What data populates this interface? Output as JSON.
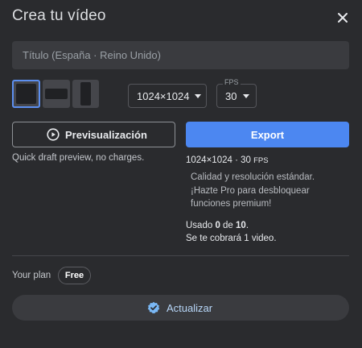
{
  "dialog": {
    "title": "Crea tu vídeo",
    "close_icon": "close-icon"
  },
  "title_field": {
    "placeholder": "Título (España · Reino Unido)",
    "value": ""
  },
  "aspect_ratios": {
    "options": [
      "square",
      "landscape",
      "portrait"
    ],
    "selected": "square"
  },
  "resolution": {
    "value": "1024×1024",
    "icon": "chevron-down-icon"
  },
  "fps": {
    "label": "FPS",
    "value": "30",
    "icon": "chevron-down-icon"
  },
  "actions": {
    "preview_label": "Previsualización",
    "preview_icon": "play-circle-icon",
    "export_label": "Export",
    "export_color": "#4c87f1"
  },
  "preview_hint": "Quick draft preview, no charges.",
  "export_info": {
    "resolution": "1024×1024",
    "separator": " · ",
    "fps_value": "30",
    "fps_unit": "FPS",
    "note": "Calidad y resolución estándar. ¡Hazte Pro para desbloquear funciones premium!",
    "usage_prefix": "Usado ",
    "usage_used": "0",
    "usage_middle": " de ",
    "usage_total": "10",
    "usage_suffix": ".",
    "charge_line": "Se te cobrará 1 video."
  },
  "plan": {
    "label": "Your plan",
    "badge": "Free"
  },
  "upgrade": {
    "label": "Actualizar",
    "icon": "verified-badge-icon",
    "icon_color": "#7ab8f5"
  },
  "colors": {
    "background": "#2a2b2e",
    "selected_border": "#5c8ff0"
  }
}
